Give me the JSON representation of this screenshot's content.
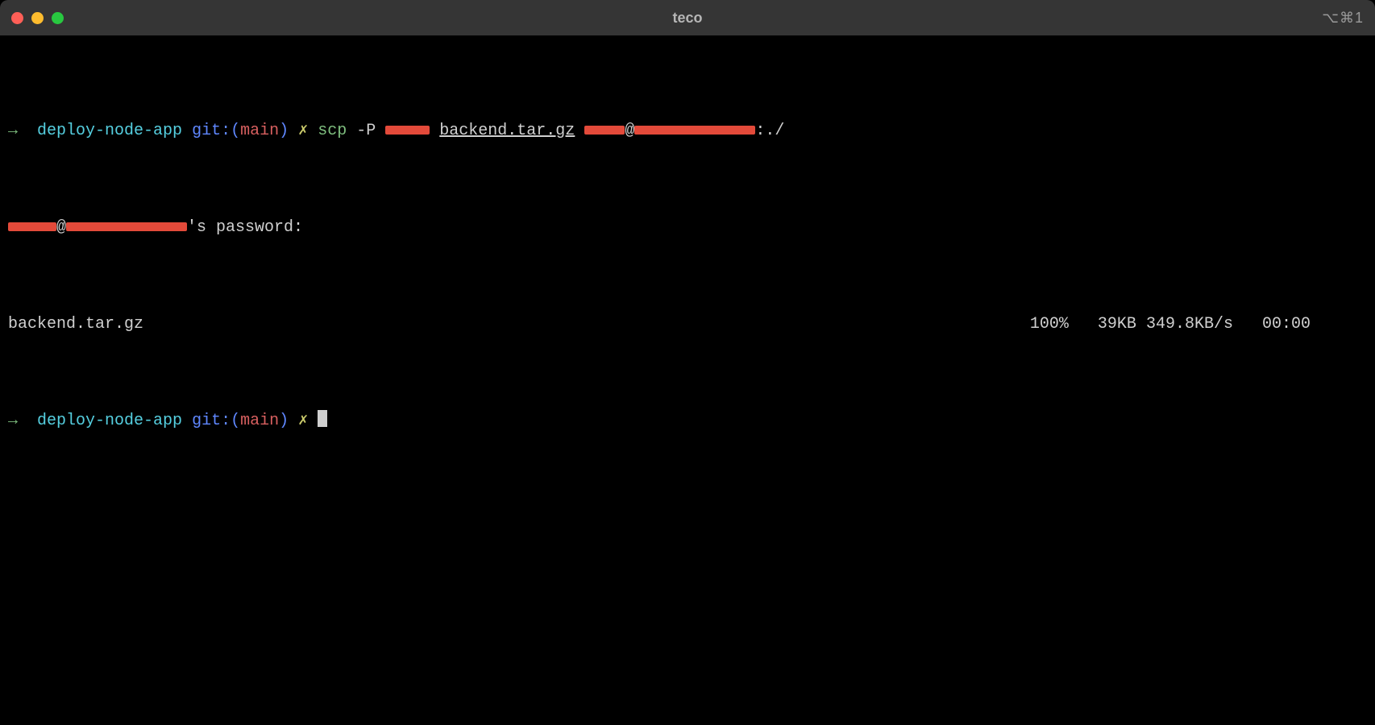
{
  "window": {
    "title": "teco",
    "session_indicator": "⌥⌘1"
  },
  "prompt": {
    "arrow": "→",
    "dirname": "deploy-node-app",
    "git_label": "git:(",
    "branch": "main",
    "git_close": ")",
    "dirty": "✗"
  },
  "cmd1": {
    "bin": "scp",
    "flag": "-P",
    "file": "backend.tar.gz",
    "at": "@",
    "dest_tail": ":./"
  },
  "pw_line": {
    "at": "@",
    "tail": "'s password:"
  },
  "transfer": {
    "file": "backend.tar.gz",
    "pct": "100%",
    "size": "39KB",
    "rate": "349.8KB/s",
    "eta": "00:00"
  }
}
